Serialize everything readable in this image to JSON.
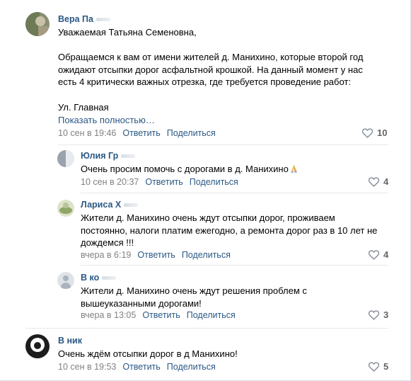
{
  "comments": [
    {
      "author": "Вера Па",
      "text_lines": [
        "Уважаемая Татьяна Семеновна,",
        "",
        "Обращаемся к вам от имени жителей д. Манихино, которые второй год",
        "ожидают отсыпки дорог асфальтной крошкой. На данный момент у нас",
        "есть 4 критически важных отрезка, где требуется проведение работ:",
        "",
        "Ул. Главная"
      ],
      "show_more": "Показать полностью…",
      "date": "10 сен в 19:46",
      "reply_label": "Ответить",
      "share_label": "Поделиться",
      "likes": "10",
      "replies": [
        {
          "author": "Юлия Гр",
          "text_lines": [
            "Очень просим помочь с дорогами в д. Манихино"
          ],
          "emoji": "folded-hands",
          "date": "10 сен в 20:37",
          "reply_label": "Ответить",
          "share_label": "Поделиться",
          "likes": "4"
        },
        {
          "author": "Лариса Х",
          "text_lines": [
            "Жители д. Манихино очень ждут отсыпки дорог, проживаем",
            "постоянно, налоги платим ежегодно, а ремонта дорог раз в 10 лет не",
            "дождемся !!!"
          ],
          "date": "вчера в 6:19",
          "reply_label": "Ответить",
          "share_label": "Поделиться",
          "likes": "4"
        },
        {
          "author": "В ко",
          "text_lines": [
            "Жители д. Манихино очень ждут решения проблем с",
            "вышеуказанными дорогами!"
          ],
          "date": "вчера в 13:05",
          "reply_label": "Ответить",
          "share_label": "Поделиться",
          "likes": "3"
        }
      ]
    },
    {
      "author": "В ник",
      "text_lines": [
        "Очень ждём отсыпки дорог в д Манихино!"
      ],
      "date": "10 сен в 19:53",
      "reply_label": "Ответить",
      "share_label": "Поделиться",
      "likes": "5"
    }
  ],
  "icons": {
    "like": "heart-outline-icon",
    "emoji": "folded-hands-emoji"
  },
  "colors": {
    "link": "#2a5885",
    "meta": "#828282",
    "like": "#656565",
    "separator": "#e7e8ec"
  }
}
